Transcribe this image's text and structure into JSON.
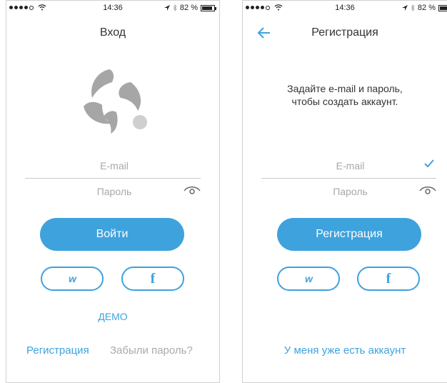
{
  "status": {
    "time": "14:36",
    "battery": "82 %",
    "battery_level": 0.82
  },
  "login": {
    "title": "Вход",
    "email_placeholder": "E-mail",
    "password_placeholder": "Пароль",
    "login_button": "Войти",
    "vk_label": "w",
    "fb_label": "f",
    "demo_link": "ДЕМО",
    "register_link": "Регистрация",
    "forgot_link": "Забыли пароль?"
  },
  "register": {
    "title": "Регистрация",
    "subtitle_line1": "Задайте e-mail и пароль,",
    "subtitle_line2": "чтобы создать аккаунт.",
    "email_placeholder": "E-mail",
    "password_placeholder": "Пароль",
    "register_button": "Регистрация",
    "vk_label": "w",
    "fb_label": "f",
    "have_account_link": "У меня уже есть аккаунт"
  },
  "colors": {
    "accent": "#3ea2dd",
    "logo_gray": "#a6a6a6",
    "logo_dot": "#cfcfcf"
  },
  "icons": [
    "wifi-icon",
    "location-arrow-icon",
    "bluetooth-icon",
    "battery-icon",
    "eye-icon",
    "back-arrow-icon",
    "checkmark-icon",
    "vk-icon",
    "facebook-icon",
    "app-logo-icon"
  ]
}
